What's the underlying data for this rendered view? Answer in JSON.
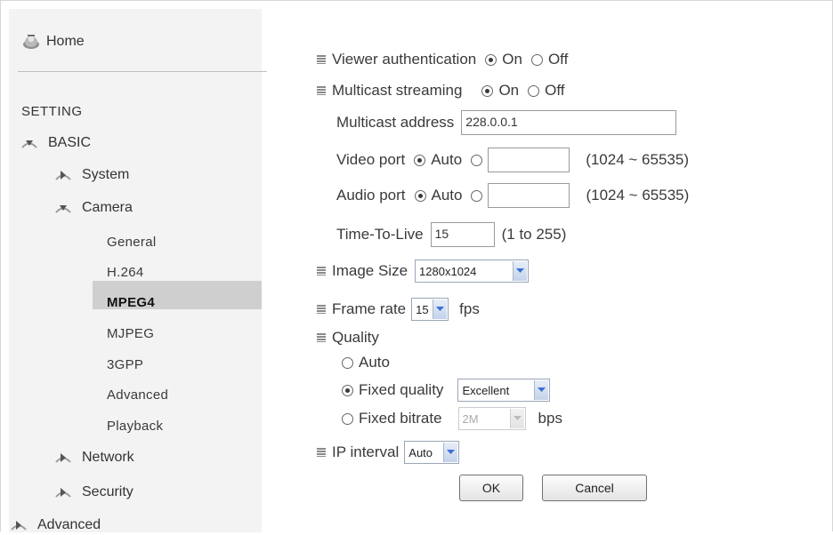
{
  "sidebar": {
    "home": "Home",
    "heading": "SETTING",
    "basic": "BASIC",
    "system": "System",
    "camera": "Camera",
    "sub": [
      "General",
      "H.264",
      "MPEG4",
      "MJPEG",
      "3GPP",
      "Advanced",
      "Playback"
    ],
    "active_sub": "MPEG4",
    "network": "Network",
    "security": "Security",
    "advanced": "Advanced"
  },
  "form": {
    "viewer_auth": {
      "label": "Viewer authentication",
      "on": "On",
      "off": "Off",
      "value": "On"
    },
    "multicast": {
      "label": "Multicast streaming",
      "on": "On",
      "off": "Off",
      "value": "On"
    },
    "multicast_address": {
      "label": "Multicast address",
      "value": "228.0.0.1"
    },
    "video_port": {
      "label": "Video port",
      "auto": "Auto",
      "value": "",
      "range": "(1024 ~ 65535)",
      "selected": "Auto"
    },
    "audio_port": {
      "label": "Audio port",
      "auto": "Auto",
      "value": "",
      "range": "(1024 ~ 65535)",
      "selected": "Auto"
    },
    "ttl": {
      "label": "Time-To-Live",
      "value": "15",
      "range": "(1 to 255)"
    },
    "image_size": {
      "label": "Image Size",
      "value": "1280x1024"
    },
    "frame_rate": {
      "label": "Frame rate",
      "value": "15",
      "unit": "fps"
    },
    "quality": {
      "label": "Quality",
      "auto": "Auto",
      "fixed_quality": "Fixed quality",
      "fixed_quality_value": "Excellent",
      "fixed_bitrate": "Fixed bitrate",
      "fixed_bitrate_value": "2M",
      "bitrate_unit": "bps",
      "selected": "Fixed quality"
    },
    "ip_interval": {
      "label": "IP interval",
      "value": "Auto"
    },
    "ok": "OK",
    "cancel": "Cancel"
  },
  "icons": {
    "home": "home-icon",
    "expanded": "chevron-down-icon",
    "collapsed": "chevron-right-icon",
    "dropdown": "dropdown-arrow-icon"
  },
  "colors": {
    "sidebar_bg": "#f3f3f3",
    "active_bg": "#cfcfcf",
    "dropdown_accent": "#3b6fd6"
  }
}
